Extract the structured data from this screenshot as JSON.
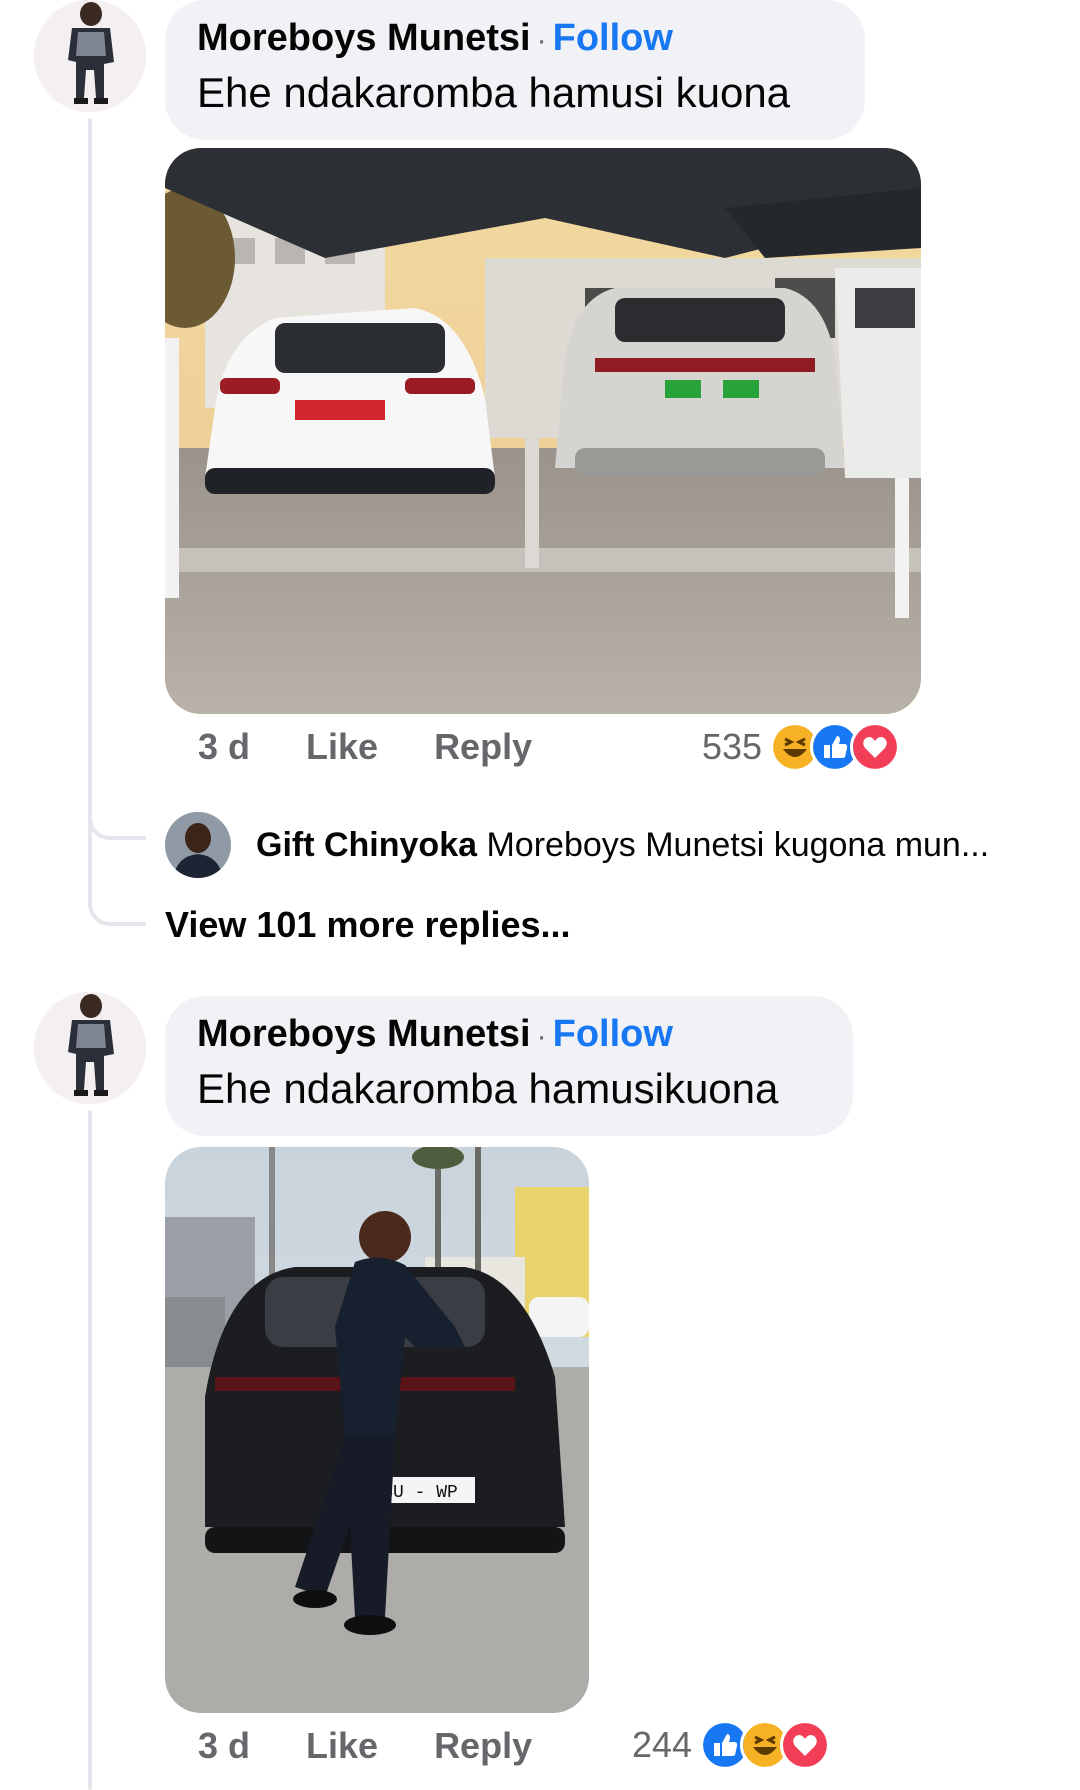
{
  "comments": [
    {
      "author": "Moreboys Munetsi",
      "follow_label": "Follow",
      "text": "Ehe ndakaromba hamusi kuona",
      "time": "3 d",
      "like_label": "Like",
      "reply_label": "Reply",
      "reaction_count": "535",
      "reactions": [
        "haha-icon",
        "like-icon",
        "love-icon"
      ]
    },
    {
      "author": "Moreboys Munetsi",
      "follow_label": "Follow",
      "text": "Ehe ndakaromba hamusikuona",
      "time": "3 d",
      "like_label": "Like",
      "reply_label": "Reply",
      "reaction_count": "244",
      "reactions": [
        "like-icon",
        "haha-icon",
        "love-icon"
      ]
    }
  ],
  "reply_preview": {
    "author": "Gift Chinyoka",
    "text": "Moreboys Munetsi kugona mun..."
  },
  "view_more": "View 101 more replies...",
  "plates": {
    "porsche": "SU - WP"
  },
  "colors": {
    "link": "#1877f2",
    "bubble": "#f0f2f5",
    "muted": "#65676b",
    "like": "#1877f2",
    "love": "#f33e58",
    "haha": "#f7b125"
  }
}
